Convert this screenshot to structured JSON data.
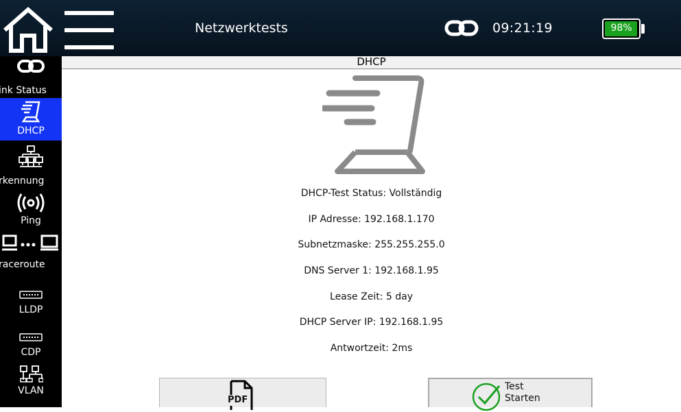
{
  "header": {
    "title": "Netzwerktests",
    "time": "09:21:19",
    "battery": {
      "label": "98%",
      "level": 0.98,
      "color": "#1aa11f"
    },
    "icons": {
      "home": "home-icon",
      "menu": "hamburger-menu-icon",
      "link": "link-chain-icon"
    }
  },
  "sidebar": {
    "accent": "#1434f5",
    "items": [
      {
        "label": "ink Status",
        "icon": "link-chain-icon"
      },
      {
        "label": "DHCP",
        "icon": "dhcp-icon",
        "active": true
      },
      {
        "label": "rkennung",
        "icon": "network-topology-icon"
      },
      {
        "label": "Ping",
        "icon": "ping-waves-icon"
      },
      {
        "label": "raceroute",
        "icon": "traceroute-computers-icon"
      },
      {
        "label": "LLDP",
        "icon": "switch-port-icon"
      },
      {
        "label": "CDP",
        "icon": "switch-port-icon"
      },
      {
        "label": "VLAN",
        "icon": "vlan-network-icon"
      }
    ]
  },
  "main": {
    "title": "DHCP",
    "icon": "dhcp-large-icon",
    "lines": [
      "DHCP-Test Status: Vollständig",
      "IP Adresse: 192.168.1.170",
      "Subnetzmaske: 255.255.255.0",
      "DNS Server 1: 192.168.1.95",
      "Lease Zeit: 5 day",
      "DHCP Server IP: 192.168.1.95",
      "Antwortzeit: 2ms"
    ]
  },
  "buttons": {
    "pdf": {
      "label": "PDF",
      "icon": "pdf-file-icon"
    },
    "start": {
      "line1": "Test",
      "line2": "Starten",
      "icon": "check-circle-icon",
      "icon_color": "#1aa11f"
    }
  }
}
